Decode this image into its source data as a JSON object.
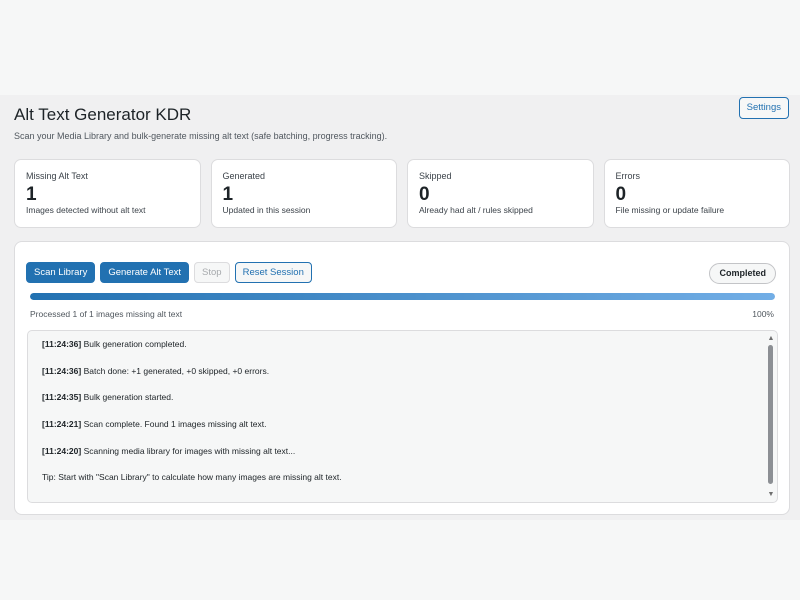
{
  "header": {
    "title": "Alt Text Generator KDR",
    "subtitle": "Scan your Media Library and bulk-generate missing alt text (safe batching, progress tracking).",
    "settings_label": "Settings"
  },
  "stats": [
    {
      "label": "Missing Alt Text",
      "value": "1",
      "desc": "Images detected without alt text"
    },
    {
      "label": "Generated",
      "value": "1",
      "desc": "Updated in this session"
    },
    {
      "label": "Skipped",
      "value": "0",
      "desc": "Already had alt / rules skipped"
    },
    {
      "label": "Errors",
      "value": "0",
      "desc": "File missing or update failure"
    }
  ],
  "toolbar": {
    "scan_label": "Scan Library",
    "generate_label": "Generate Alt Text",
    "stop_label": "Stop",
    "reset_label": "Reset Session"
  },
  "status": "Completed",
  "progress": {
    "fraction": 1.0,
    "text": "Processed 1 of 1 images missing alt text",
    "percent_label": "100%"
  },
  "log": [
    {
      "time": "[11:24:36]",
      "message": "Bulk generation completed."
    },
    {
      "time": "[11:24:36]",
      "message": "Batch done: +1 generated, +0 skipped, +0 errors."
    },
    {
      "time": "[11:24:35]",
      "message": "Bulk generation started."
    },
    {
      "time": "[11:24:21]",
      "message": "Scan complete. Found 1 images missing alt text."
    },
    {
      "time": "[11:24:20]",
      "message": "Scanning media library for images with missing alt text..."
    },
    {
      "time": "",
      "message": "Tip: Start with \"Scan Library\" to calculate how many images are missing alt text."
    }
  ],
  "icons": {
    "scroll_up": "scroll-up-arrow-icon",
    "scroll_down": "scroll-down-arrow-icon"
  },
  "colors": {
    "accent": "#2271b1",
    "progress_end": "#72aee6"
  }
}
